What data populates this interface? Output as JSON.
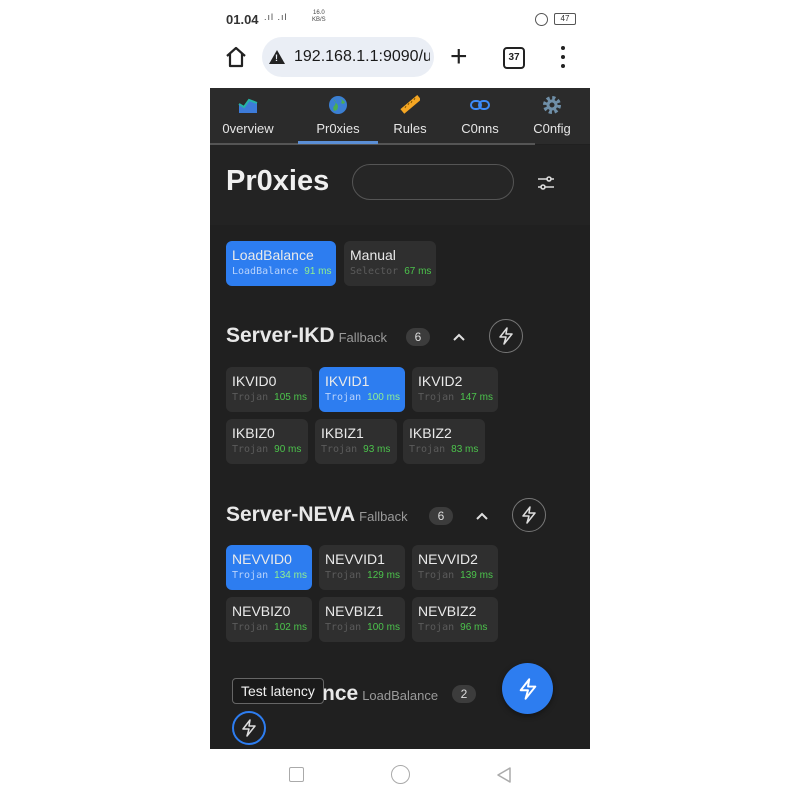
{
  "status_bar": {
    "time": "01.04",
    "signal": ".ıl .ıl",
    "speed_value": "16.0",
    "speed_unit": "KB/S",
    "battery": "47"
  },
  "browser": {
    "url": "192.168.1.1:9090/u",
    "tab_count": "37"
  },
  "nav": {
    "items": [
      {
        "label": "0verview",
        "icon": "chart-area-icon"
      },
      {
        "label": "Pr0xies",
        "icon": "globe-icon"
      },
      {
        "label": "Rules",
        "icon": "ruler-icon"
      },
      {
        "label": "C0nns",
        "icon": "link-icon"
      },
      {
        "label": "C0nfig",
        "icon": "gear-icon"
      }
    ],
    "active_index": 1
  },
  "page": {
    "title": "Pr0xies",
    "search_placeholder": ""
  },
  "groups": [
    {
      "title": "",
      "proxies": [
        {
          "name": "LoadBalance",
          "type": "LoadBalance",
          "latency": "91 ms",
          "selected": true
        },
        {
          "name": "Manual",
          "type": "Selector",
          "latency": "67 ms",
          "selected": false
        }
      ]
    },
    {
      "title": "Server-IKD",
      "type": "Fallback",
      "count": "6",
      "proxies": [
        {
          "name": "IKVID0",
          "type": "Trojan",
          "latency": "105 ms",
          "selected": false
        },
        {
          "name": "IKVID1",
          "type": "Trojan",
          "latency": "100 ms",
          "selected": true
        },
        {
          "name": "IKVID2",
          "type": "Trojan",
          "latency": "147 ms",
          "selected": false
        },
        {
          "name": "IKBIZ0",
          "type": "Trojan",
          "latency": "90 ms",
          "selected": false
        },
        {
          "name": "IKBIZ1",
          "type": "Trojan",
          "latency": "93 ms",
          "selected": false
        },
        {
          "name": "IKBIZ2",
          "type": "Trojan",
          "latency": "83 ms",
          "selected": false
        }
      ]
    },
    {
      "title": "Server-NEVA",
      "type": "Fallback",
      "count": "6",
      "proxies": [
        {
          "name": "NEVVID0",
          "type": "Trojan",
          "latency": "134 ms",
          "selected": true
        },
        {
          "name": "NEVVID1",
          "type": "Trojan",
          "latency": "129 ms",
          "selected": false
        },
        {
          "name": "NEVVID2",
          "type": "Trojan",
          "latency": "139 ms",
          "selected": false
        },
        {
          "name": "NEVBIZ0",
          "type": "Trojan",
          "latency": "102 ms",
          "selected": false
        },
        {
          "name": "NEVBIZ1",
          "type": "Trojan",
          "latency": "100 ms",
          "selected": false
        },
        {
          "name": "NEVBIZ2",
          "type": "Trojan",
          "latency": "96 ms",
          "selected": false
        }
      ]
    },
    {
      "title_partial": "nce",
      "type": "LoadBalance",
      "count": "2"
    }
  ],
  "tooltip": "Test latency",
  "colors": {
    "accent": "#2d7df0",
    "latency_green": "#4cc34c",
    "background": "#202020"
  }
}
